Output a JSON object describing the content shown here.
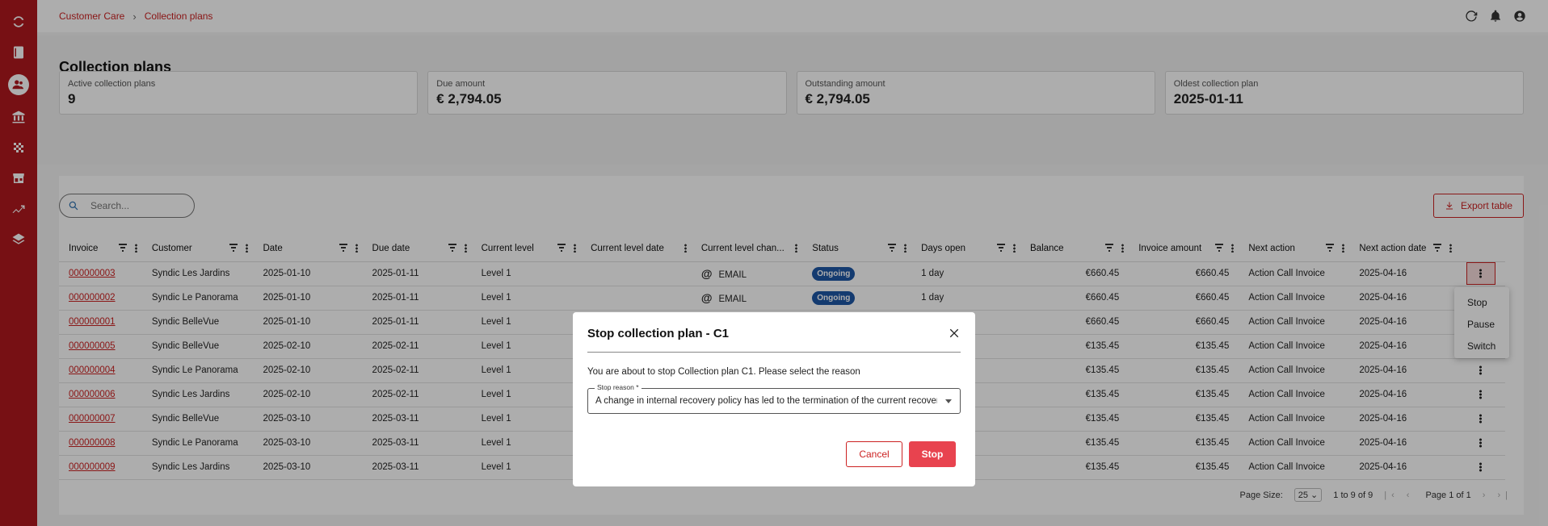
{
  "sidebar": {
    "items": [
      {
        "icon": "logo-icon"
      },
      {
        "icon": "book-icon"
      },
      {
        "icon": "users-icon",
        "active": true
      },
      {
        "icon": "bank-icon"
      },
      {
        "icon": "checkered-icon"
      },
      {
        "icon": "store-icon"
      },
      {
        "icon": "trend-icon"
      },
      {
        "icon": "layers-icon"
      }
    ]
  },
  "breadcrumb": {
    "root": "Customer Care",
    "separator": "›",
    "current": "Collection plans"
  },
  "page": {
    "title": "Collection plans"
  },
  "kpis": [
    {
      "label": "Active collection plans",
      "value": "9"
    },
    {
      "label": "Due amount",
      "value": "€ 2,794.05"
    },
    {
      "label": "Outstanding amount",
      "value": "€ 2,794.05"
    },
    {
      "label": "Oldest collection plan",
      "value": "2025-01-11"
    }
  ],
  "search": {
    "placeholder": "Search..."
  },
  "export": {
    "label": "Export table"
  },
  "table": {
    "columns": [
      "Invoice",
      "Customer",
      "Date",
      "Due date",
      "Current level",
      "Current level date",
      "Current level chan...",
      "Status",
      "Days open",
      "Balance",
      "Invoice amount",
      "Next action",
      "Next action date"
    ],
    "rows": [
      {
        "invoice": "000000003",
        "customer": "Syndic Les Jardins",
        "date": "2025-01-10",
        "due": "2025-01-11",
        "level": "Level 1",
        "channel": "EMAIL",
        "status": "Ongoing",
        "days": "1 day",
        "balance": "€660.45",
        "amount": "€660.45",
        "next": "Action Call Invoice",
        "next_date": "2025-04-16"
      },
      {
        "invoice": "000000002",
        "customer": "Syndic Le Panorama",
        "date": "2025-01-10",
        "due": "2025-01-11",
        "level": "Level 1",
        "channel": "EMAIL",
        "status": "Ongoing",
        "days": "1 day",
        "balance": "€660.45",
        "amount": "€660.45",
        "next": "Action Call Invoice",
        "next_date": "2025-04-16"
      },
      {
        "invoice": "000000001",
        "customer": "Syndic BelleVue",
        "date": "2025-01-10",
        "due": "2025-01-11",
        "level": "Level 1",
        "channel": "",
        "status": "",
        "days": "",
        "balance": "€660.45",
        "amount": "€660.45",
        "next": "Action Call Invoice",
        "next_date": "2025-04-16"
      },
      {
        "invoice": "000000005",
        "customer": "Syndic BelleVue",
        "date": "2025-02-10",
        "due": "2025-02-11",
        "level": "Level 1",
        "channel": "",
        "status": "",
        "days": "",
        "balance": "€135.45",
        "amount": "€135.45",
        "next": "Action Call Invoice",
        "next_date": "2025-04-16"
      },
      {
        "invoice": "000000004",
        "customer": "Syndic Le Panorama",
        "date": "2025-02-10",
        "due": "2025-02-11",
        "level": "Level 1",
        "channel": "",
        "status": "",
        "days": "",
        "balance": "€135.45",
        "amount": "€135.45",
        "next": "Action Call Invoice",
        "next_date": "2025-04-16"
      },
      {
        "invoice": "000000006",
        "customer": "Syndic Les Jardins",
        "date": "2025-02-10",
        "due": "2025-02-11",
        "level": "Level 1",
        "channel": "",
        "status": "",
        "days": "",
        "balance": "€135.45",
        "amount": "€135.45",
        "next": "Action Call Invoice",
        "next_date": "2025-04-16"
      },
      {
        "invoice": "000000007",
        "customer": "Syndic BelleVue",
        "date": "2025-03-10",
        "due": "2025-03-11",
        "level": "Level 1",
        "channel": "",
        "status": "",
        "days": "",
        "balance": "€135.45",
        "amount": "€135.45",
        "next": "Action Call Invoice",
        "next_date": "2025-04-16"
      },
      {
        "invoice": "000000008",
        "customer": "Syndic Le Panorama",
        "date": "2025-03-10",
        "due": "2025-03-11",
        "level": "Level 1",
        "channel": "",
        "status": "",
        "days": "",
        "balance": "€135.45",
        "amount": "€135.45",
        "next": "Action Call Invoice",
        "next_date": "2025-04-16"
      },
      {
        "invoice": "000000009",
        "customer": "Syndic Les Jardins",
        "date": "2025-03-10",
        "due": "2025-03-11",
        "level": "Level 1",
        "channel": "",
        "status": "",
        "days": "",
        "balance": "€135.45",
        "amount": "€135.45",
        "next": "Action Call Invoice",
        "next_date": "2025-04-16"
      }
    ]
  },
  "pager": {
    "page_size_label": "Page Size:",
    "page_size": "25",
    "range": "1 to 9 of 9",
    "page": "Page 1 of 1"
  },
  "row_menu": {
    "items": [
      "Stop",
      "Pause",
      "Switch"
    ]
  },
  "dialog": {
    "title": "Stop collection plan - C1",
    "text": "You are about to stop Collection plan C1. Please select the reason",
    "reason_label": "Stop reason *",
    "reason_value": "A change in internal recovery policy has led to the termination of the current recovery plan",
    "cancel": "Cancel",
    "stop": "Stop"
  },
  "colors": {
    "brand": "#b0191e",
    "accent": "#c22222",
    "stop_button": "#e8434f",
    "badge": "#1e57a6"
  }
}
